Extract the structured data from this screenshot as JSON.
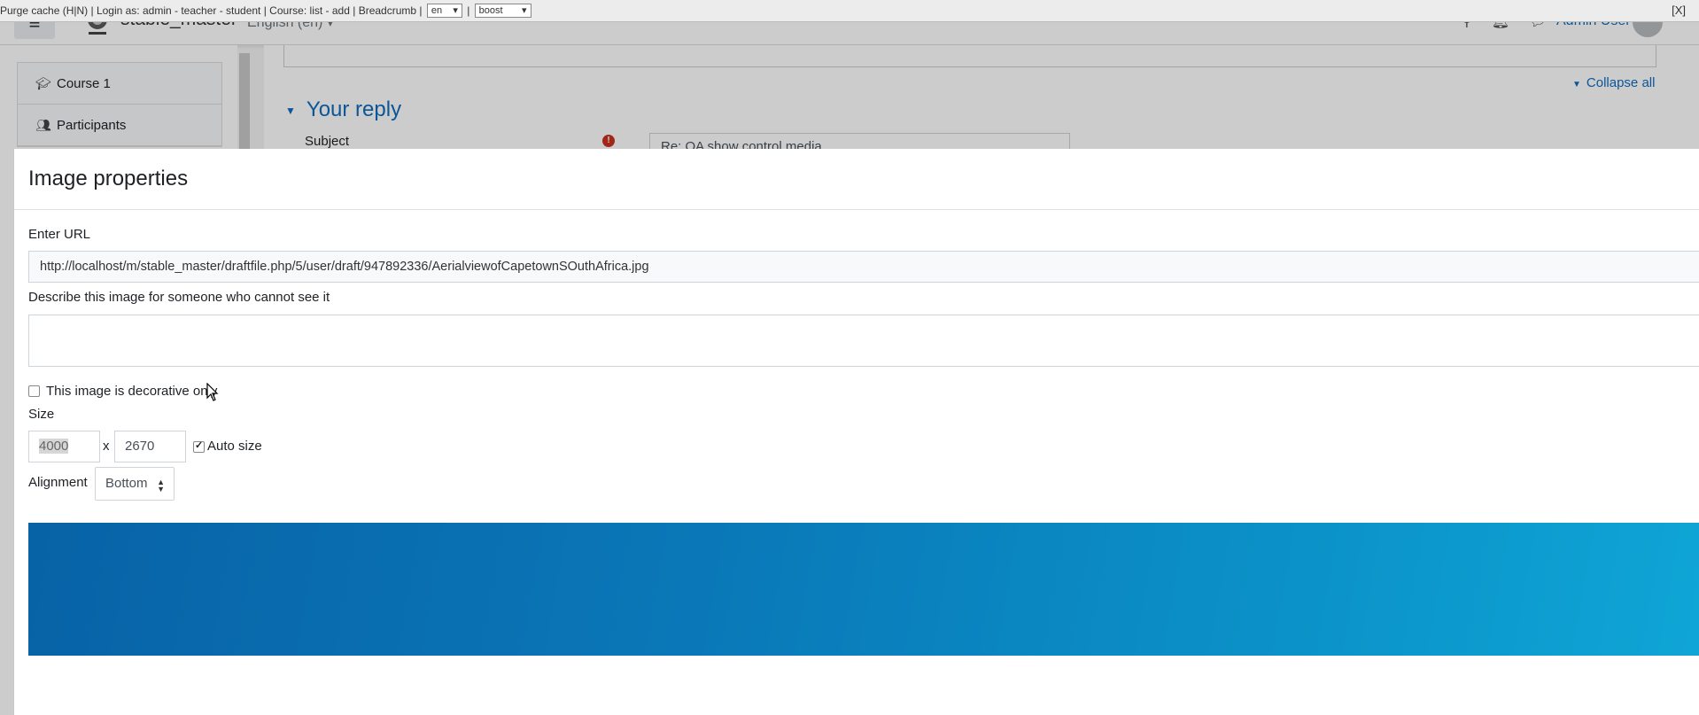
{
  "dev_bar": {
    "text": "Purge cache (H|N) | Login as: ",
    "login_links": "admin - teacher - student",
    "course_sep": " | Course: ",
    "course_links": "list - add",
    "breadcrumb_sep": " | ",
    "breadcrumb": "Breadcrumb",
    "tail_sep": " | ",
    "lang_select": "en",
    "pipe": " | ",
    "theme_select": "boost",
    "close": "[X]"
  },
  "navbar": {
    "site_name": "stable_master",
    "language": "English (en)",
    "user_name": "Admin User",
    "icons": [
      "search-icon",
      "bell-icon",
      "chat-icon"
    ]
  },
  "drawer": {
    "items": [
      {
        "label": "Course 1",
        "icon": "graduation-cap-icon"
      },
      {
        "label": "Participants",
        "icon": "users-icon"
      }
    ]
  },
  "main": {
    "collapse_all": "Collapse all",
    "section_heading": "Your reply",
    "subject_label": "Subject",
    "subject_value": "Re: QA show control media"
  },
  "dialog": {
    "title": "Image properties",
    "url_label": "Enter URL",
    "url_value": "http://localhost/m/stable_master/draftfile.php/5/user/draft/947892336/AerialviewofCapetownSOuthAfrica.jpg",
    "alt_label": "Describe this image for someone who cannot see it",
    "decorative_label": "This image is decorative only",
    "decorative_checked": false,
    "size_label": "Size",
    "width": "4000",
    "separator": "x",
    "height": "2670",
    "auto_size_label": "Auto size",
    "auto_size_checked": true,
    "alignment_label": "Alignment",
    "alignment_value": "Bottom"
  },
  "colors": {
    "link": "#0f6cbf",
    "required": "#ca3120",
    "preview_start": "#0862a6",
    "preview_end": "#0fa6d6"
  }
}
